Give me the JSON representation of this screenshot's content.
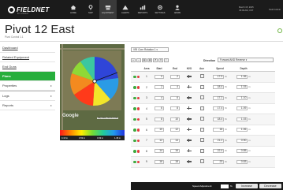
{
  "brand": {
    "name": "FIELDNET",
    "tagline": "BY LINDSAY"
  },
  "nav": [
    {
      "label": "HOME",
      "icon": "home-icon"
    },
    {
      "label": "MAP",
      "icon": "map-pin-icon"
    },
    {
      "label": "EQUIPMENT",
      "icon": "equipment-icon"
    },
    {
      "label": "ALERTS",
      "icon": "alert-icon"
    },
    {
      "label": "REPORTS",
      "icon": "chart-icon"
    },
    {
      "label": "SETTINGS",
      "icon": "gear-icon"
    },
    {
      "label": "ADMIN",
      "icon": "user-icon"
    }
  ],
  "header": {
    "datetime_line1": "March 15, 2015",
    "datetime_line2": "06:09 AM, CST",
    "user_link": "Field Admin",
    "title": "Pivot 12 East",
    "subtitle": "Pivot Control 1.1"
  },
  "sidebar": {
    "items": [
      {
        "label": "Dashboard"
      },
      {
        "label": "Related Equipment"
      },
      {
        "label": "End Guns"
      },
      {
        "label": "Plans"
      },
      {
        "label": "Properties"
      },
      {
        "label": "Logs"
      },
      {
        "label": "Reports"
      }
    ]
  },
  "map": {
    "google_label": "Google",
    "terms_label": "Map Data | Terms of Use"
  },
  "legend": {
    "labels": [
      "0.18 in",
      "0.59 in",
      "0.99 in",
      "1.38 in"
    ]
  },
  "plan": {
    "selected": "VRI Corn Rotation 1",
    "direction_label": "Direction",
    "direction_value": "Forward AND Reverse"
  },
  "toolbar": [
    "+",
    "−",
    "▤",
    "▤",
    "↺",
    "✕",
    "↑"
  ],
  "table": {
    "headers": [
      "Area",
      "Start",
      "End",
      "H2O",
      "Aux",
      "Speed",
      "Depth"
    ],
    "rows": [
      {
        "area": "1",
        "start": "0",
        "end": "2",
        "speed": "17.9",
        "depth": "1.06"
      },
      {
        "area": "2",
        "start": "2",
        "end": "4",
        "speed": "18.4",
        "depth": "1.03"
      },
      {
        "area": "3",
        "start": "4",
        "end": "6",
        "speed": "17.2",
        "depth": "1.10"
      },
      {
        "area": "4",
        "start": "6",
        "end": "8",
        "speed": "17.4",
        "depth": "1.09"
      },
      {
        "area": "5",
        "start": "8",
        "end": "10",
        "speed": "18.4",
        "depth": "1.03"
      },
      {
        "area": "6",
        "start": "10",
        "end": "12",
        "speed": "18",
        "depth": "1.06"
      },
      {
        "area": "7",
        "start": "12",
        "end": "14",
        "speed": "21.2",
        "depth": "0.90"
      },
      {
        "area": "8",
        "start": "14",
        "end": "16",
        "speed": "22.4",
        "depth": "0.85"
      },
      {
        "area": "9",
        "start": "16",
        "end": "18",
        "speed": "23",
        "depth": "0.83"
      }
    ],
    "pct_unit": "%",
    "in_unit": "in"
  },
  "footer": {
    "speed_label": "Speed Adjustment:",
    "pct": "%",
    "increase": "Increase",
    "decrease": "Decrease"
  },
  "colors": {
    "active_green": "#27ae3c",
    "topbar": "#1b1b1b"
  }
}
